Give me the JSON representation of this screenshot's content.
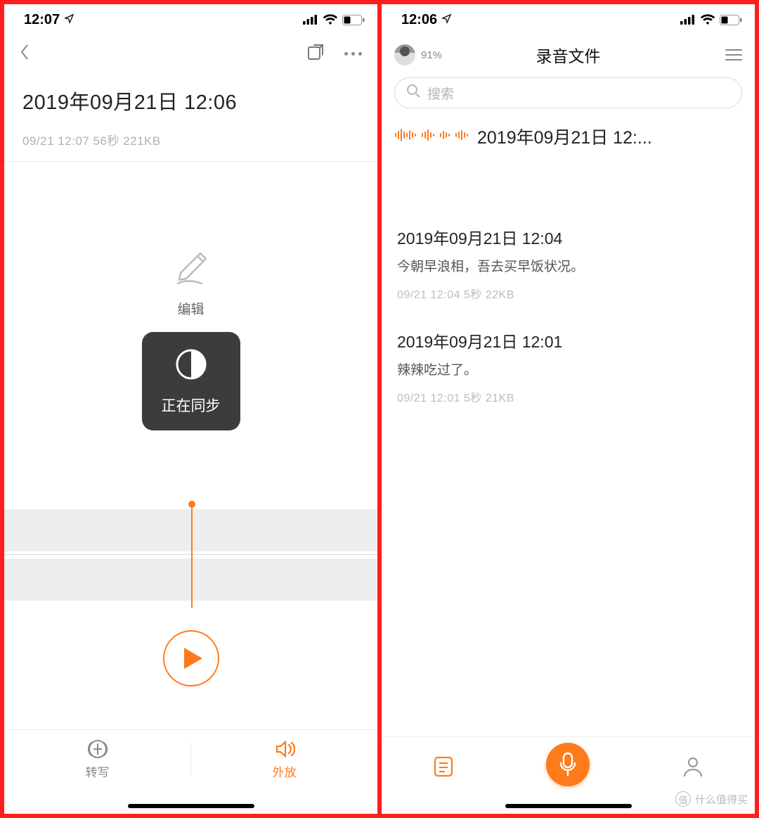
{
  "colors": {
    "accent": "#ff7a1a",
    "border_red": "#ff1e1e"
  },
  "left": {
    "statusbar": {
      "time": "12:07"
    },
    "title": "2019年09月21日 12:06",
    "meta": "09/21 12:07 56秒 221KB",
    "edit_label": "编辑",
    "toast_label": "正在同步",
    "bottom": {
      "transcribe": "转写",
      "speaker": "外放"
    }
  },
  "right": {
    "statusbar": {
      "time": "12:06"
    },
    "header": {
      "battery_pct": "91%",
      "title": "录音文件"
    },
    "search": {
      "placeholder": "搜索"
    },
    "current": {
      "title": "2019年09月21日 12:..."
    },
    "items": [
      {
        "title": "2019年09月21日 12:04",
        "body": "今朝早浪相，吾去买早饭状况。",
        "meta": "09/21 12:04 5秒 22KB"
      },
      {
        "title": "2019年09月21日 12:01",
        "body": "辣辣吃过了。",
        "meta": "09/21 12:01 5秒 21KB"
      }
    ]
  },
  "watermark": {
    "badge": "值",
    "text": "什么值得买"
  }
}
